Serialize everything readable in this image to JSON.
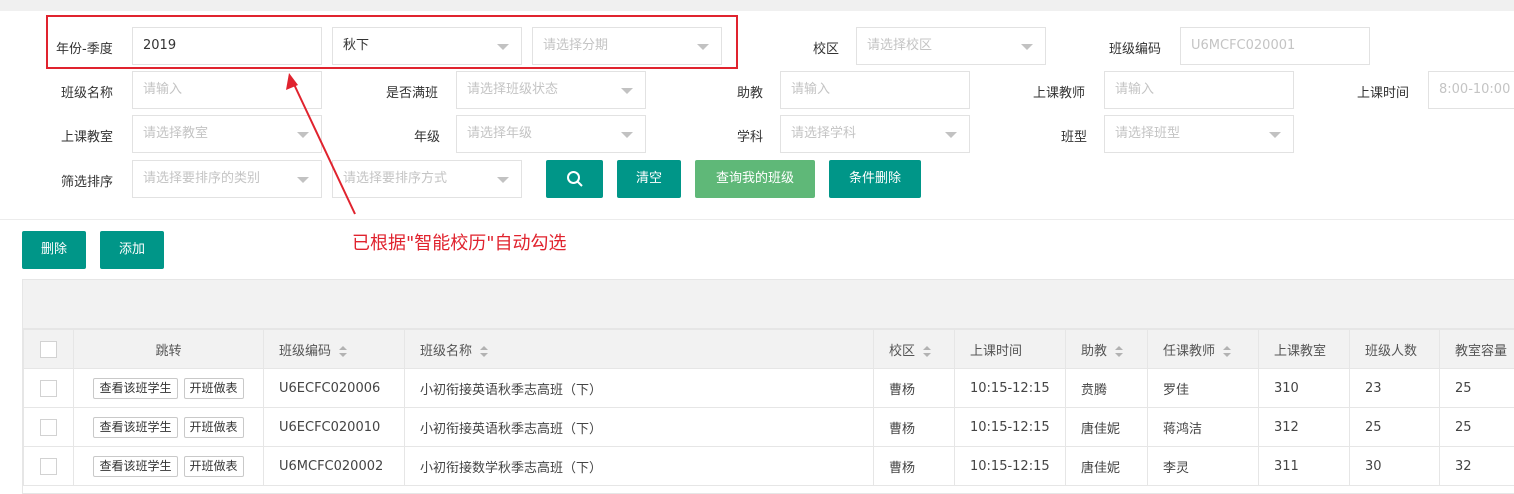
{
  "filters": {
    "year_season": {
      "label": "年份-季度",
      "year": "2019",
      "season": "秋下",
      "period_placeholder": "请选择分期"
    },
    "campus": {
      "label": "校区",
      "placeholder": "请选择校区"
    },
    "class_code": {
      "label": "班级编码",
      "placeholder": "U6MCFC020001"
    },
    "class_name": {
      "label": "班级名称",
      "placeholder": "请输入"
    },
    "is_full": {
      "label": "是否满班",
      "placeholder": "请选择班级状态"
    },
    "assistant": {
      "label": "助教",
      "placeholder": "请输入"
    },
    "teacher": {
      "label": "上课教师",
      "placeholder": "请输入"
    },
    "class_time": {
      "label": "上课时间",
      "placeholder": "8:00-10:00"
    },
    "classroom": {
      "label": "上课教室",
      "placeholder": "请选择教室"
    },
    "grade": {
      "label": "年级",
      "placeholder": "请选择年级"
    },
    "subject": {
      "label": "学科",
      "placeholder": "请选择学科"
    },
    "class_type": {
      "label": "班型",
      "placeholder": "请选择班型"
    },
    "sort": {
      "label": "筛选排序",
      "category_placeholder": "请选择要排序的类别",
      "order_placeholder": "请选择要排序方式"
    }
  },
  "buttons": {
    "clear": "清空",
    "my_classes": "查询我的班级",
    "conditional_delete": "条件删除",
    "delete": "删除",
    "add": "添加"
  },
  "annotation": "已根据\"智能校历\"自动勾选",
  "table": {
    "headers": [
      "跳转",
      "班级编码",
      "班级名称",
      "校区",
      "上课时间",
      "助教",
      "任课教师",
      "上课教室",
      "班级人数",
      "教室容量"
    ],
    "row_actions": {
      "view_students": "查看该班学生",
      "open_table": "开班做表"
    },
    "rows": [
      [
        "U6ECFC020006",
        "小初衔接英语秋季志高班（下）",
        "曹杨",
        "10:15-12:15",
        "贲腾",
        "罗佳",
        "310",
        "23",
        "25"
      ],
      [
        "U6ECFC020010",
        "小初衔接英语秋季志高班（下）",
        "曹杨",
        "10:15-12:15",
        "唐佳妮",
        "蒋鸿洁",
        "312",
        "25",
        "25"
      ],
      [
        "U6MCFC020002",
        "小初衔接数学秋季志高班（下）",
        "曹杨",
        "10:15-12:15",
        "唐佳妮",
        "李灵",
        "311",
        "30",
        "32"
      ]
    ]
  },
  "colors": {
    "primary": "#009688",
    "light": "#5fb878",
    "highlight": "#e0232e"
  }
}
